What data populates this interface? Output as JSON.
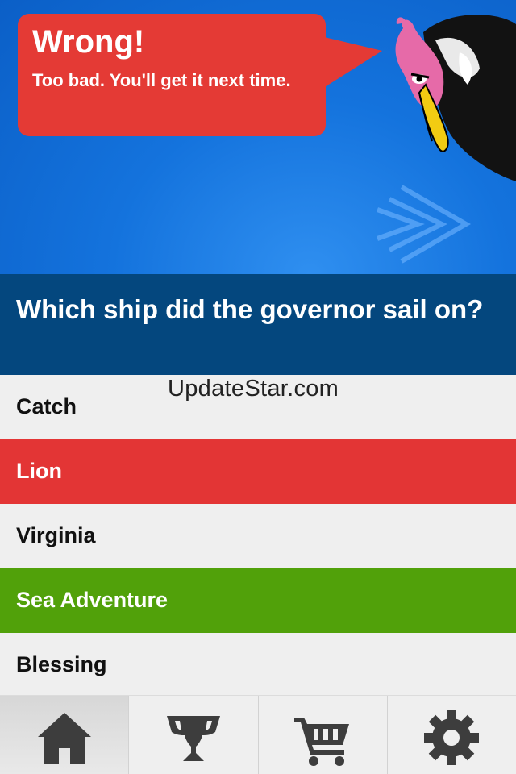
{
  "feedback": {
    "title": "Wrong!",
    "message": "Too bad.  You'll get it next time."
  },
  "question": {
    "text": "Which ship did the governor sail on?"
  },
  "answers": [
    {
      "label": "Catch",
      "state": "neutral"
    },
    {
      "label": "Lion",
      "state": "wrong"
    },
    {
      "label": "Virginia",
      "state": "neutral"
    },
    {
      "label": "Sea Adventure",
      "state": "correct"
    },
    {
      "label": "Blessing",
      "state": "neutral"
    }
  ],
  "watermark": "UpdateStar.com",
  "tabbar": {
    "tabs": [
      {
        "icon": "home-icon",
        "active": true
      },
      {
        "icon": "trophy-icon",
        "active": false
      },
      {
        "icon": "cart-icon",
        "active": false
      },
      {
        "icon": "gear-icon",
        "active": false
      }
    ]
  },
  "colors": {
    "hero_blue": "#1473dd",
    "question_bar": "#04477e",
    "wrong_red": "#e33535",
    "correct_green": "#51a10a",
    "neutral_gray": "#efefef"
  }
}
